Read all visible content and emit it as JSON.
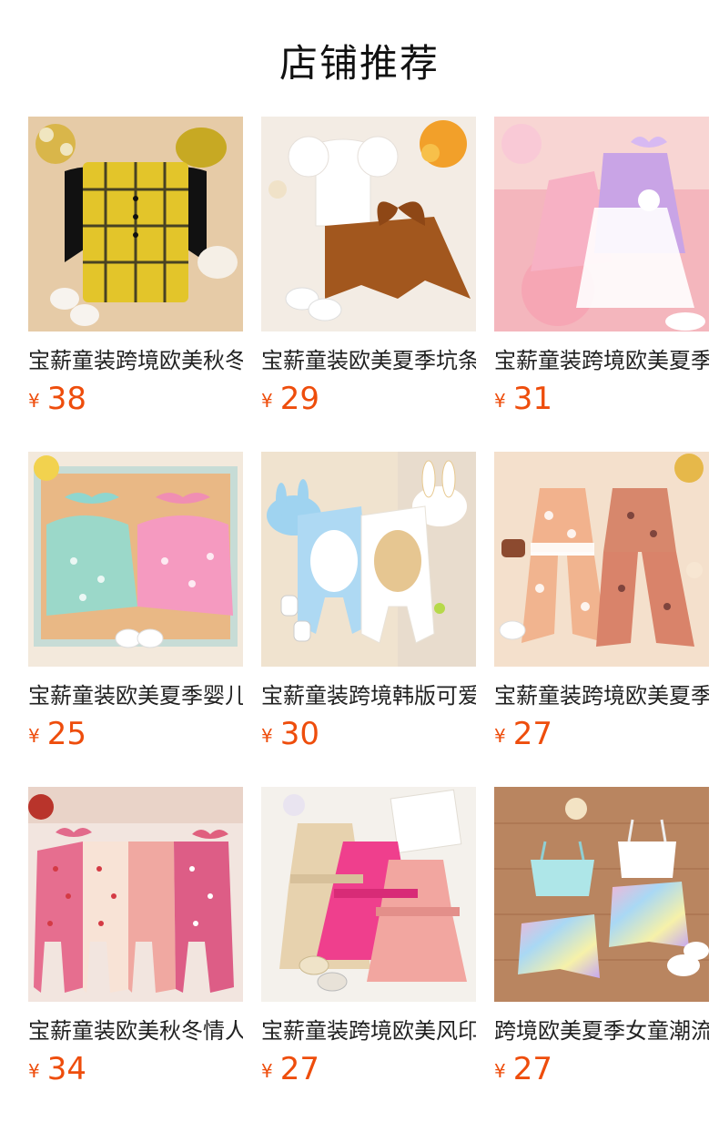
{
  "header": {
    "title": "店铺推荐"
  },
  "products": [
    {
      "name": "宝薪童装跨境欧美秋冬",
      "currency": "¥",
      "price": "38",
      "image": "yellow-plaid-overall-dress-photo"
    },
    {
      "name": "宝薪童装欧美夏季坑条",
      "currency": "¥",
      "price": "29",
      "image": "white-top-brown-bow-skirt-photo"
    },
    {
      "name": "宝薪童装跨境欧美夏季",
      "currency": "¥",
      "price": "31",
      "image": "pink-purple-tutu-dresses-photo"
    },
    {
      "name": "宝薪童装欧美夏季婴儿",
      "currency": "¥",
      "price": "25",
      "image": "floral-romper-dresses-photo"
    },
    {
      "name": "宝薪童装跨境韩版可爱",
      "currency": "¥",
      "price": "30",
      "image": "bunny-jumpsuits-photo"
    },
    {
      "name": "宝薪童装跨境欧美夏季",
      "currency": "¥",
      "price": "27",
      "image": "floral-bell-bottom-sets-photo"
    },
    {
      "name": "宝薪童装欧美秋冬情人",
      "currency": "¥",
      "price": "34",
      "image": "pink-heart-footed-rompers-photo"
    },
    {
      "name": "宝薪童装跨境欧美风印",
      "currency": "¥",
      "price": "27",
      "image": "tutu-trench-dresses-photo"
    },
    {
      "name": "跨境欧美夏季女童潮流",
      "currency": "¥",
      "price": "27",
      "image": "tie-dye-shorts-sets-photo"
    }
  ]
}
